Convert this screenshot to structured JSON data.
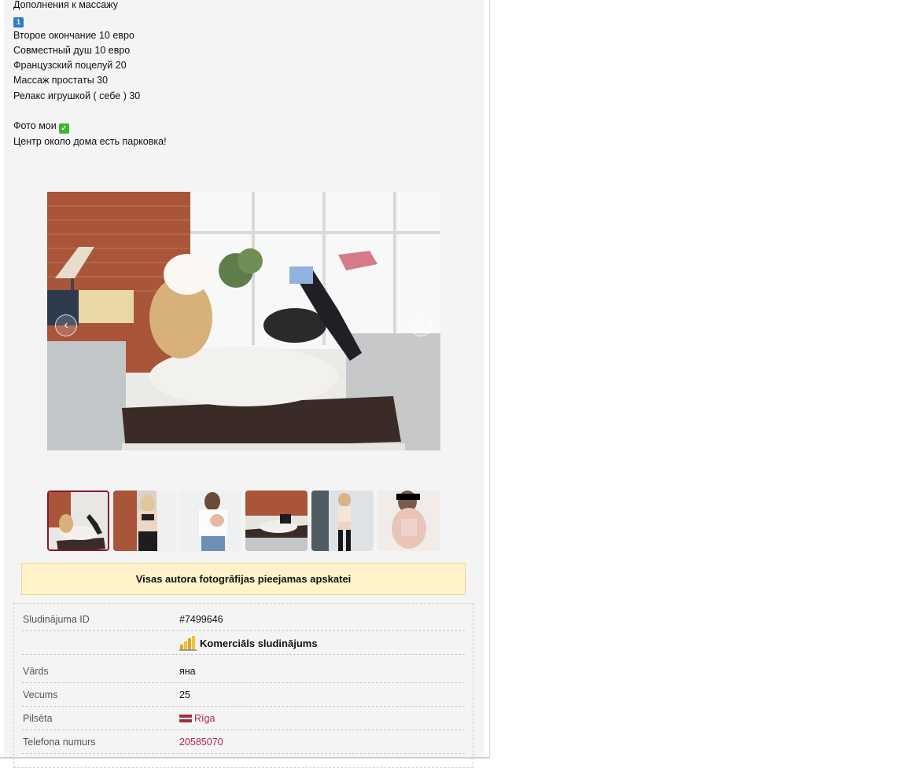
{
  "description": {
    "lines": [
      "Дополнения к массажу",
      "",
      "Второе окончание 10 евро",
      "Совместный душ 10 евро",
      "Французский поцелуй 20",
      "Массаж простаты 30",
      "Релакс игрушкой ( себе ) 30",
      "",
      "Фото мои",
      "Центр около дома есть парковка!"
    ],
    "emoji_one": "1",
    "emoji_check": "✓"
  },
  "gallery": {
    "prev_arrow": "‹",
    "next_arrow": "›",
    "active_index": 0,
    "thumbnails": [
      {
        "icon": "photo-thumbnail"
      },
      {
        "icon": "photo-thumbnail"
      },
      {
        "icon": "photo-thumbnail"
      },
      {
        "icon": "photo-thumbnail"
      },
      {
        "icon": "photo-thumbnail"
      },
      {
        "icon": "photo-thumbnail"
      }
    ]
  },
  "notice": {
    "text": "Visas autora fotogrāfijas pieejamas apskatei"
  },
  "info": {
    "rows": [
      {
        "label": "Sludinājuma ID",
        "value": "#7499646"
      },
      {
        "label": "",
        "value": "Komerciāls sludinājums",
        "icon": "coins-chart-icon"
      },
      {
        "label": "Vārds",
        "value": "яна"
      },
      {
        "label": "Vecums",
        "value": "25"
      },
      {
        "label": "Pilsēta",
        "value": "Rīga",
        "icon": "latvia-flag-icon"
      },
      {
        "label": "Telefona numurs",
        "value": "20585070"
      }
    ]
  },
  "colors": {
    "accent": "#b0264c",
    "notice_bg": "#fff3c9",
    "active_thumb_border": "#8b1433"
  }
}
